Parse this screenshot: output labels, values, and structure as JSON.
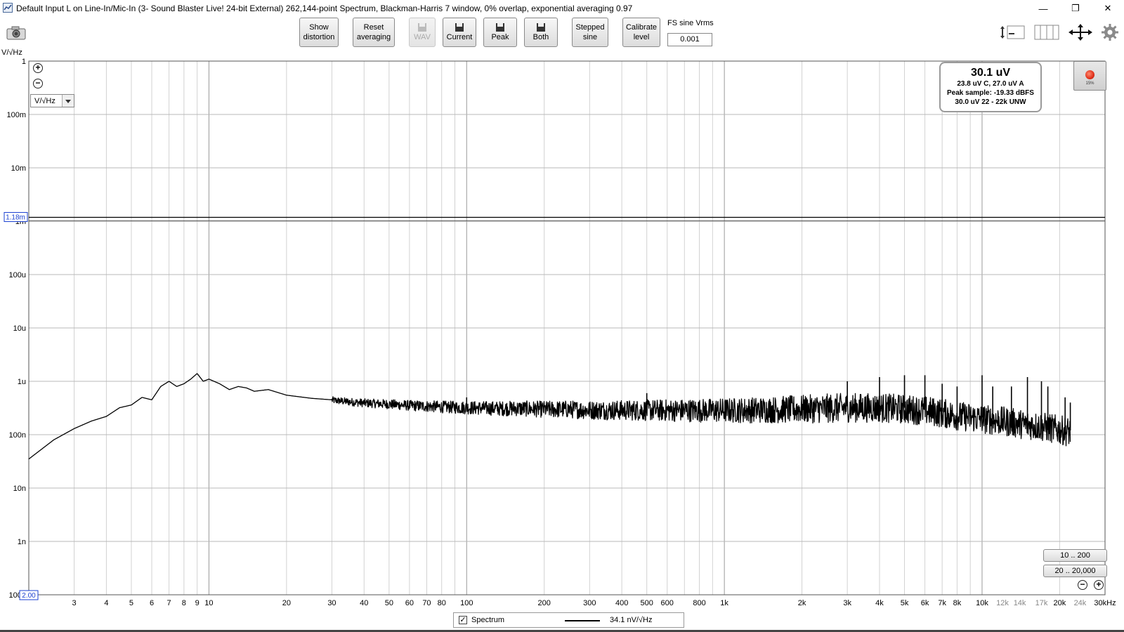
{
  "window": {
    "title": "Default Input L on Line-In/Mic-In (3- Sound Blaster Live! 24-bit External) 262,144-point Spectrum, Blackman-Harris 7 window, 0% overlap, exponential averaging 0.97",
    "minimize_glyph": "—",
    "maximize_glyph": "❐",
    "close_glyph": "✕"
  },
  "toolbar": {
    "show_distortion": [
      "Show",
      "distortion"
    ],
    "reset_averaging": [
      "Reset",
      "averaging"
    ],
    "wav": "WAV",
    "current": "Current",
    "peak": "Peak",
    "both": "Both",
    "stepped_sine": [
      "Stepped",
      "sine"
    ],
    "calibrate_level": [
      "Calibrate",
      "level"
    ],
    "fs_sine_label": "FS sine Vrms",
    "fs_sine_value": "0.001",
    "icons": [
      "camera-icon",
      "save-icon",
      "layout-icon",
      "bars-icon",
      "move-arrows-icon",
      "gear-icon"
    ]
  },
  "graph": {
    "y_unit": "V/√Hz",
    "unit_select": "V/√Hz",
    "cursor_value": "1.18m",
    "x_start_box": "2.00",
    "range_buttons": [
      "10 .. 200",
      "20 .. 20,000"
    ]
  },
  "readout": {
    "main": "30.1 uV",
    "line1": "23.8 uV C, 27.0 uV A",
    "line2": "Peak sample: -19.33 dBFS",
    "line3": "30.0 uV 22 - 22k UNW"
  },
  "record": {
    "percent": "15%"
  },
  "legend": {
    "checked": true,
    "name": "Spectrum",
    "value": "34.1 nV/√Hz",
    "color": "#000000"
  },
  "chart_data": {
    "type": "line",
    "x_scale": "log",
    "y_scale": "log",
    "xlim": [
      2,
      30000
    ],
    "ylim": [
      1e-10,
      1
    ],
    "x_ticks": [
      {
        "v": 2,
        "label": ""
      },
      {
        "v": 3,
        "label": "3"
      },
      {
        "v": 4,
        "label": "4"
      },
      {
        "v": 5,
        "label": "5"
      },
      {
        "v": 6,
        "label": "6"
      },
      {
        "v": 7,
        "label": "7"
      },
      {
        "v": 8,
        "label": "8"
      },
      {
        "v": 9,
        "label": "9"
      },
      {
        "v": 10,
        "label": "10"
      },
      {
        "v": 20,
        "label": "20"
      },
      {
        "v": 30,
        "label": "30"
      },
      {
        "v": 40,
        "label": "40"
      },
      {
        "v": 50,
        "label": "50"
      },
      {
        "v": 60,
        "label": "60"
      },
      {
        "v": 70,
        "label": "70"
      },
      {
        "v": 80,
        "label": "80"
      },
      {
        "v": 100,
        "label": "100"
      },
      {
        "v": 200,
        "label": "200"
      },
      {
        "v": 300,
        "label": "300"
      },
      {
        "v": 400,
        "label": "400"
      },
      {
        "v": 500,
        "label": "500"
      },
      {
        "v": 600,
        "label": "600"
      },
      {
        "v": 800,
        "label": "800"
      },
      {
        "v": 1000,
        "label": "1k"
      },
      {
        "v": 2000,
        "label": "2k"
      },
      {
        "v": 3000,
        "label": "3k"
      },
      {
        "v": 4000,
        "label": "4k"
      },
      {
        "v": 5000,
        "label": "5k"
      },
      {
        "v": 6000,
        "label": "6k"
      },
      {
        "v": 7000,
        "label": "7k"
      },
      {
        "v": 8000,
        "label": "8k"
      },
      {
        "v": 10000,
        "label": "10k"
      },
      {
        "v": 12000,
        "label": "12k"
      },
      {
        "v": 14000,
        "label": "14k"
      },
      {
        "v": 17000,
        "label": "17k"
      },
      {
        "v": 20000,
        "label": "20k"
      },
      {
        "v": 24000,
        "label": "24k"
      },
      {
        "v": 30000,
        "label": "30kHz"
      }
    ],
    "y_ticks": [
      {
        "v": 1,
        "label": "1"
      },
      {
        "v": 0.1,
        "label": "100m"
      },
      {
        "v": 0.01,
        "label": "10m"
      },
      {
        "v": 0.001,
        "label": "1m"
      },
      {
        "v": 0.0001,
        "label": "100u"
      },
      {
        "v": 1e-05,
        "label": "10u"
      },
      {
        "v": 1e-06,
        "label": "1u"
      },
      {
        "v": 1e-07,
        "label": "100n"
      },
      {
        "v": 1e-08,
        "label": "10n"
      },
      {
        "v": 1e-09,
        "label": "1n"
      },
      {
        "v": 1e-10,
        "label": "100p"
      }
    ],
    "grid": true,
    "reference_line": 0.00118,
    "series": [
      {
        "name": "Spectrum",
        "x": [
          2,
          2.5,
          3,
          3.5,
          4,
          4.5,
          5,
          5.5,
          6,
          6.5,
          7,
          7.5,
          8,
          8.5,
          9,
          9.5,
          10,
          11,
          12,
          13,
          14,
          15,
          17,
          20,
          25,
          30,
          35,
          40,
          50,
          60,
          70,
          80,
          100,
          130,
          160,
          200,
          250,
          300,
          400,
          500,
          600,
          800,
          1000,
          1500,
          2000,
          3000,
          4000,
          5000,
          6000,
          7000,
          8000,
          10000,
          12000,
          14000,
          17000,
          20000,
          22000
        ],
        "y": [
          3.5e-08,
          8e-08,
          1.3e-07,
          1.8e-07,
          2.2e-07,
          3.2e-07,
          3.6e-07,
          5e-07,
          4.5e-07,
          8e-07,
          1e-06,
          8e-07,
          9e-07,
          1.1e-06,
          1.4e-06,
          1e-06,
          1.1e-06,
          9e-07,
          7e-07,
          8e-07,
          7.5e-07,
          6.5e-07,
          7e-07,
          5.5e-07,
          4.8e-07,
          4.5e-07,
          4.2e-07,
          4e-07,
          3.8e-07,
          3.6e-07,
          3.5e-07,
          3.4e-07,
          3.3e-07,
          3.2e-07,
          3.2e-07,
          3.1e-07,
          3.1e-07,
          3e-07,
          3e-07,
          3e-07,
          3e-07,
          3e-07,
          3e-07,
          3.1e-07,
          3.2e-07,
          3.4e-07,
          3.4e-07,
          3.2e-07,
          3e-07,
          2.7e-07,
          2.4e-07,
          2.1e-07,
          1.9e-07,
          1.7e-07,
          1.5e-07,
          1.3e-07,
          1.2e-07
        ]
      }
    ],
    "noise_band_fraction": [
      0.03,
      0.55
    ],
    "spikes": [
      {
        "x": 100,
        "y": 5e-07
      },
      {
        "x": 500,
        "y": 6e-07
      },
      {
        "x": 3000,
        "y": 1e-06
      },
      {
        "x": 4000,
        "y": 1.2e-06
      },
      {
        "x": 5000,
        "y": 1.3e-06
      },
      {
        "x": 6000,
        "y": 1.3e-06
      },
      {
        "x": 7000,
        "y": 9e-07
      },
      {
        "x": 8000,
        "y": 8e-07
      },
      {
        "x": 10000,
        "y": 1.3e-06
      },
      {
        "x": 11000,
        "y": 8e-07
      },
      {
        "x": 13000,
        "y": 8e-07
      },
      {
        "x": 15000,
        "y": 1.2e-06
      },
      {
        "x": 17000,
        "y": 1e-06
      },
      {
        "x": 18000,
        "y": 8e-07
      },
      {
        "x": 21000,
        "y": 5e-07
      },
      {
        "x": 22000,
        "y": 4e-07
      }
    ]
  }
}
